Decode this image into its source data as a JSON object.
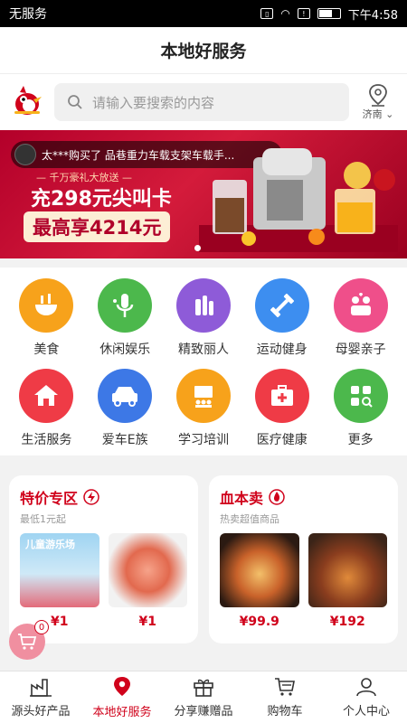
{
  "status_bar": {
    "carrier": "无服务",
    "time": "下午4:58"
  },
  "header": {
    "title": "本地好服务"
  },
  "search": {
    "placeholder": "请输入要搜索的内容",
    "location": "济南"
  },
  "banner": {
    "ticker": "太***购买了 品巷重力车载支架车载手...",
    "subtitle": "— 千万豪礼大放送 —",
    "line1": "充298元尖叫卡",
    "line2": "最高享4214元",
    "active_dot": 0
  },
  "categories": [
    {
      "label": "美食",
      "icon": "bowl-icon",
      "color": "#f7a21b"
    },
    {
      "label": "休闲娱乐",
      "icon": "microphone-icon",
      "color": "#4cb84c"
    },
    {
      "label": "精致丽人",
      "icon": "cosmetics-icon",
      "color": "#8e5bd8"
    },
    {
      "label": "运动健身",
      "icon": "dumbbell-icon",
      "color": "#3d8ef0"
    },
    {
      "label": "母婴亲子",
      "icon": "family-icon",
      "color": "#ef4f8a"
    },
    {
      "label": "生活服务",
      "icon": "house-icon",
      "color": "#ef3b46"
    },
    {
      "label": "爱车E族",
      "icon": "car-icon",
      "color": "#3d78e6"
    },
    {
      "label": "学习培训",
      "icon": "classroom-icon",
      "color": "#f7a21b"
    },
    {
      "label": "医疗健康",
      "icon": "medical-kit-icon",
      "color": "#ef3b46"
    },
    {
      "label": "更多",
      "icon": "more-grid-icon",
      "color": "#4cb84c"
    }
  ],
  "promos": [
    {
      "title": "特价专区",
      "subtitle": "最低1元起",
      "items": [
        {
          "name": "儿童游乐场",
          "price": "¥1"
        },
        {
          "price": "¥1"
        }
      ]
    },
    {
      "title": "血本卖",
      "subtitle": "热卖超值商品",
      "items": [
        {
          "price": "¥99.9"
        },
        {
          "price": "¥192"
        }
      ]
    }
  ],
  "cart_float": {
    "count": "0"
  },
  "tabbar": [
    {
      "label": "源头好产品",
      "icon": "factory-icon",
      "active": false
    },
    {
      "label": "本地好服务",
      "icon": "location-pin-icon",
      "active": true
    },
    {
      "label": "分享赚赠品",
      "icon": "gift-icon",
      "active": false
    },
    {
      "label": "购物车",
      "icon": "cart-icon",
      "active": false
    },
    {
      "label": "个人中心",
      "icon": "user-icon",
      "active": false
    }
  ],
  "colors": {
    "brand_red": "#d0021b",
    "banner_red": "#c4102f"
  }
}
